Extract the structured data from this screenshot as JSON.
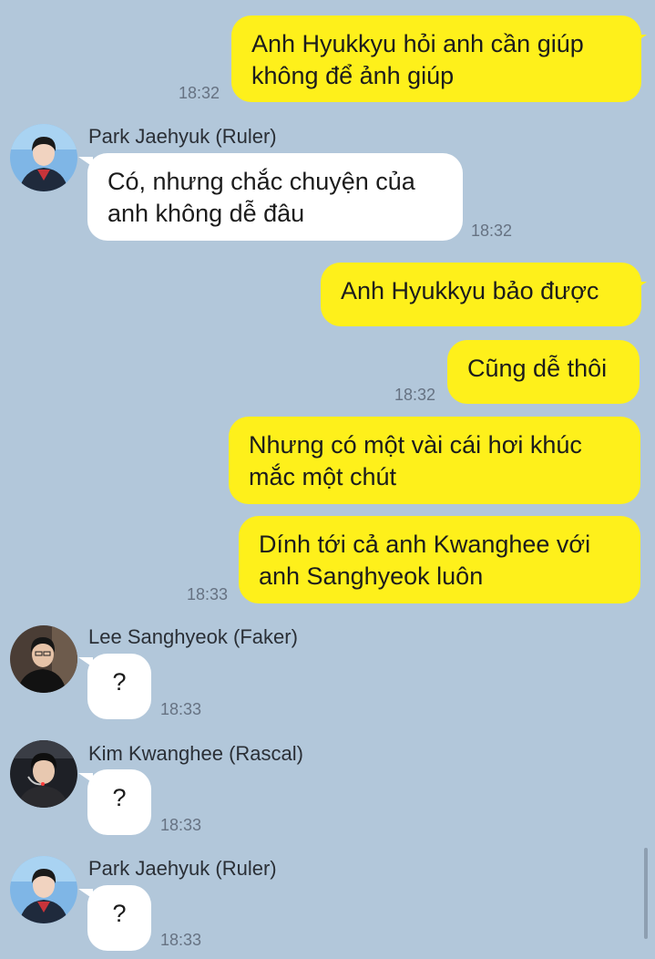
{
  "messages": [
    {
      "sender": "me",
      "text": "Anh Hyukkyu hỏi anh cần giúp\nkhông để ảnh giúp",
      "time": "18:32"
    },
    {
      "sender": "Park Jaehyuk (Ruler)",
      "text": "Có, nhưng chắc chuyện của\nanh không dễ đâu",
      "time": "18:32"
    },
    {
      "sender": "me",
      "text": "Anh Hyukkyu bảo được"
    },
    {
      "sender": "me",
      "text": "Cũng dễ thôi",
      "time": "18:32"
    },
    {
      "sender": "me",
      "text": "Nhưng có một vài cái hơi khúc\nmắc một chút"
    },
    {
      "sender": "me",
      "text": "Dính tới cả anh Kwanghee với\nanh Sanghyeok luôn",
      "time": "18:33"
    },
    {
      "sender": "Lee Sanghyeok (Faker)",
      "text": "?",
      "time": "18:33"
    },
    {
      "sender": "Kim Kwanghee (Rascal)",
      "text": "?",
      "time": "18:33"
    },
    {
      "sender": "Park Jaehyuk (Ruler)",
      "text": "?",
      "time": "18:33"
    }
  ],
  "colors": {
    "background": "#b2c7da",
    "outgoing_bubble": "#fef01b",
    "incoming_bubble": "#ffffff"
  }
}
